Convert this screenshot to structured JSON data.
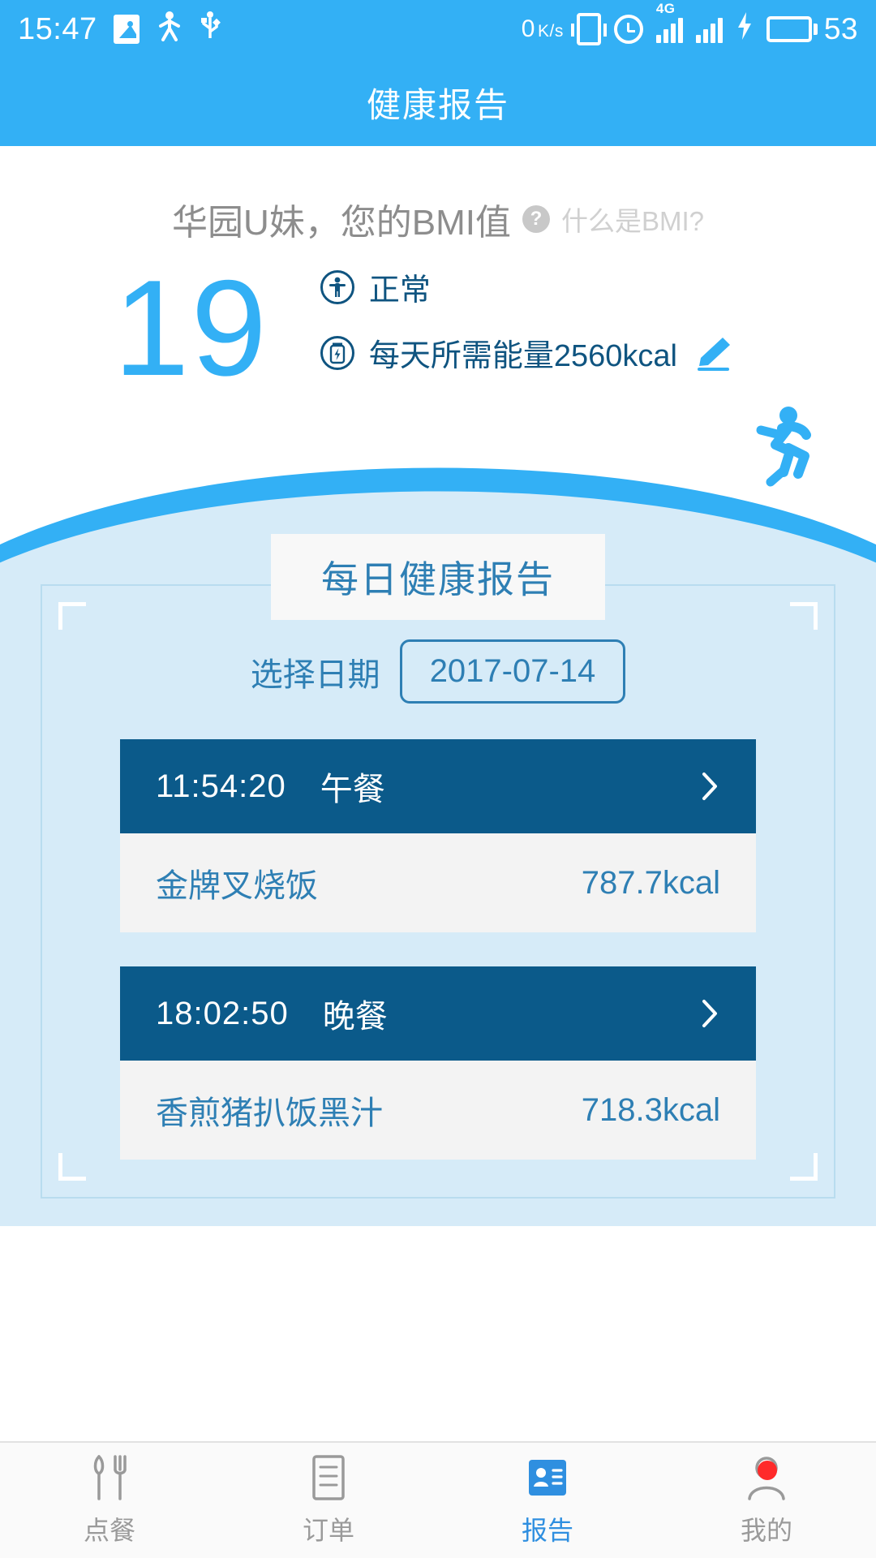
{
  "status_bar": {
    "time": "15:47",
    "network_speed": "0",
    "network_speed_unit_top": "K",
    "network_speed_unit_bottom": "s",
    "signal_tag": "4G",
    "battery_level": "53",
    "icons": [
      "gallery-icon",
      "person-icon",
      "usb-icon",
      "vibrate-icon",
      "alarm-clock-icon",
      "signal-4g-icon",
      "signal-icon",
      "charging-bolt-icon",
      "battery-icon"
    ]
  },
  "app_bar": {
    "title": "健康报告"
  },
  "hero": {
    "greeting": "华园U妹，您的BMI值",
    "help_label": "什么是BMI?",
    "help_badge": "?",
    "bmi_value": "19",
    "status_text": "正常",
    "energy_text": "每天所需能量2560kcal",
    "accent_color": "#33b0f5",
    "dark_blue": "#0f5480"
  },
  "report": {
    "card_title": "每日健康报告",
    "date_label": "选择日期",
    "date_value": "2017-07-14",
    "meals": [
      {
        "time": "11:54:20",
        "name": "午餐",
        "item_name": "金牌叉烧饭",
        "item_kcal": "787.7kcal"
      },
      {
        "time": "18:02:50",
        "name": "晚餐",
        "item_name": "香煎猪扒饭黑汁",
        "item_kcal": "718.3kcal"
      }
    ]
  },
  "tabbar": {
    "items": [
      {
        "label": "点餐",
        "icon": "cutlery-icon",
        "active": false
      },
      {
        "label": "订单",
        "icon": "list-icon",
        "active": false
      },
      {
        "label": "报告",
        "icon": "report-card-icon",
        "active": true
      },
      {
        "label": "我的",
        "icon": "user-icon",
        "active": false,
        "badge": true
      }
    ],
    "active_color": "#2f8fe0",
    "inactive_color": "#9a9a9a",
    "badge_color": "#ff2a2a"
  }
}
